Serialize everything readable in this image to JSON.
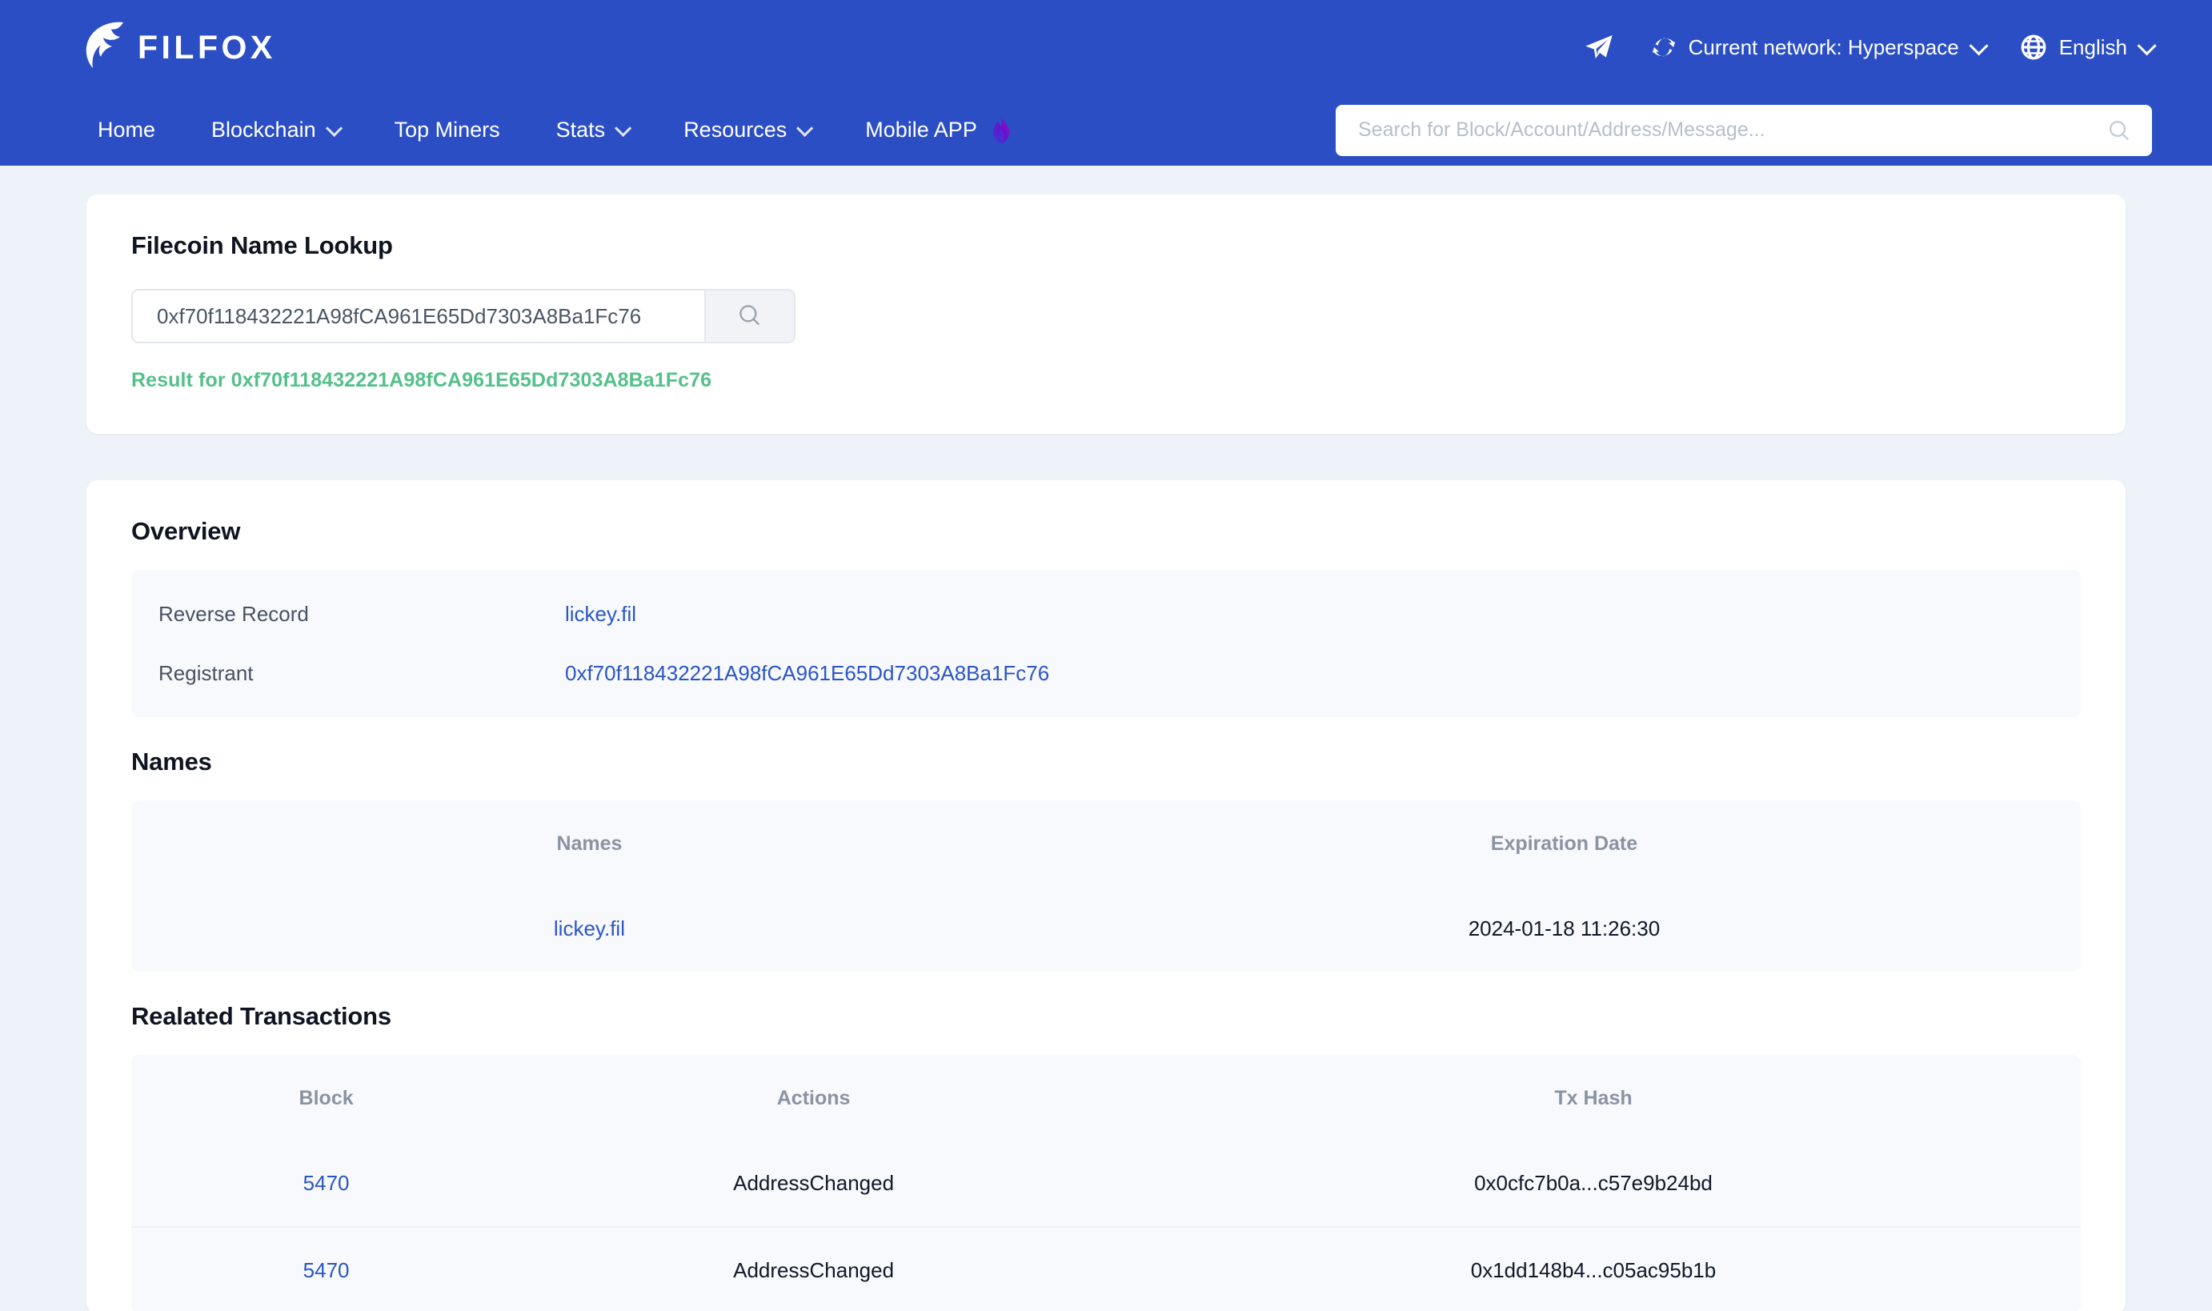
{
  "header": {
    "brand": "FILFOX",
    "brand_icon": "filfox-fox-logo",
    "telegram_icon": "telegram-paper-plane-icon",
    "network_icon": "refresh-sync-icon",
    "network_label": "Current network: Hyperspace",
    "language_icon": "globe-icon",
    "language_label": "English",
    "chevron_icon": "chevron-down-icon",
    "accent_color": "#2b4ec4"
  },
  "nav": {
    "items": [
      {
        "label": "Home",
        "has_chevron": false
      },
      {
        "label": "Blockchain",
        "has_chevron": true
      },
      {
        "label": "Top Miners",
        "has_chevron": false
      },
      {
        "label": "Stats",
        "has_chevron": true
      },
      {
        "label": "Resources",
        "has_chevron": true
      },
      {
        "label": "Mobile APP",
        "has_chevron": false,
        "badge_icon": "flame-icon"
      }
    ],
    "search": {
      "placeholder": "Search for Block/Account/Address/Message...",
      "value": "",
      "icon": "search-icon"
    }
  },
  "lookup": {
    "title": "Filecoin Name Lookup",
    "input_value": "0xf70f118432221A98fCA961E65Dd7303A8Ba1Fc76",
    "input_placeholder": "Search name or address",
    "button_icon": "search-icon",
    "result_text": "Result for 0xf70f118432221A98fCA961E65Dd7303A8Ba1Fc76",
    "result_color": "#54c08a"
  },
  "overview": {
    "title": "Overview",
    "rows": [
      {
        "label": "Reverse Record",
        "value": "lickey.fil",
        "is_link": true
      },
      {
        "label": "Registrant",
        "value": "0xf70f118432221A98fCA961E65Dd7303A8Ba1Fc76",
        "is_link": true
      }
    ]
  },
  "names": {
    "title": "Names",
    "columns": [
      "Names",
      "Expiration Date"
    ],
    "rows": [
      {
        "name": "lickey.fil",
        "expiration": "2024-01-18 11:26:30"
      }
    ]
  },
  "transactions": {
    "title": "Realated Transactions",
    "columns": [
      "Block",
      "Actions",
      "Tx Hash"
    ],
    "rows": [
      {
        "block": "5470",
        "action": "AddressChanged",
        "hash": "0x0cfc7b0a...c57e9b24bd"
      },
      {
        "block": "5470",
        "action": "AddressChanged",
        "hash": "0x1dd148b4...c05ac95b1b"
      }
    ]
  }
}
